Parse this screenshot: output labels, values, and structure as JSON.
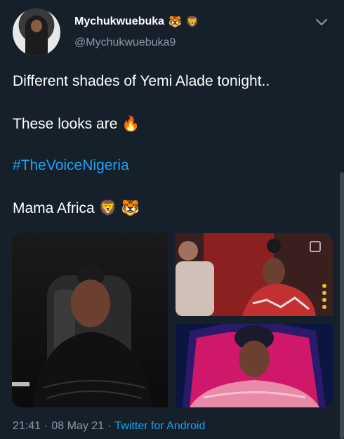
{
  "colors": {
    "background": "#15202b",
    "text": "#ffffff",
    "secondary_text": "#8899a6",
    "accent": "#1da1f2"
  },
  "author": {
    "display_name": "Mychukwuebuka",
    "name_emojis": [
      "🐯",
      "🦁"
    ],
    "handle": "@Mychukwuebuka9",
    "avatar_icon": "profile-photo"
  },
  "tweet": {
    "line1": "Different shades of Yemi Alade tonight..",
    "line2_text": "These looks are",
    "line2_emoji": "🔥",
    "hashtag": "#TheVoiceNigeria",
    "line4_text": "Mama Africa",
    "line4_emojis": [
      "🦁",
      "🐯"
    ]
  },
  "media": {
    "count": 3
  },
  "meta": {
    "time": "21:41",
    "separator": "·",
    "date": "08 May 21",
    "source": "Twitter for Android"
  }
}
